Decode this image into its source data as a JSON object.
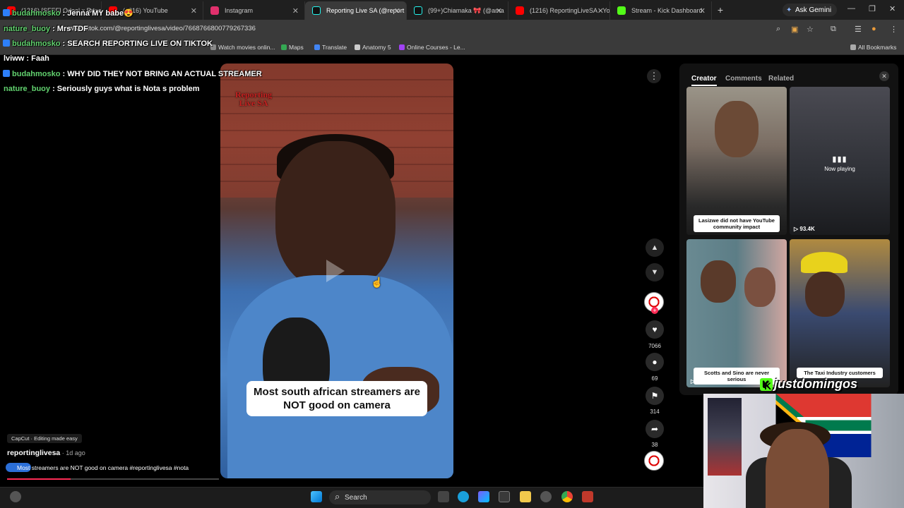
{
  "browser": {
    "tabs": [
      {
        "label": "(1216) [SFEF] Odeal x Rosa",
        "color": "#ff0000"
      },
      {
        "label": "(1216) YouTube",
        "color": "#ff0000"
      },
      {
        "label": "Instagram",
        "color": "#e1306c"
      },
      {
        "label": "Reporting Live SA (@report",
        "color": "#111111",
        "active": true
      },
      {
        "label": "(99+)Chiamaka 🎀 (@ama",
        "color": "#111111"
      },
      {
        "label": "(1216) ReportingLiveSA - Yo",
        "color": "#ff0000"
      },
      {
        "label": "Stream - Kick Dashboard",
        "color": "#53fc18"
      }
    ],
    "new_tab": "+",
    "gemini": "Ask Gemini",
    "url": "www.tiktok.com/@reportinglivesa/video/7668766800779267336",
    "bookmarks": [
      "Watch movies onlin...",
      "Maps",
      "Translate",
      "Anatomy 5",
      "Online Courses - Le..."
    ],
    "all_bookmarks": "All Bookmarks"
  },
  "chat": [
    {
      "user": "budahmosko",
      "text": " : Jenna MY babe😍",
      "badge": true
    },
    {
      "user": "nature_buoy",
      "text": " : Mrs TDF",
      "badge": false
    },
    {
      "user": "budahmosko",
      "text": " : SEARCH REPORTING LIVE ON TIKTOK",
      "badge": true
    },
    {
      "user": "",
      "text": "lviww : Faah",
      "badge": false
    },
    {
      "user": "budahmosko",
      "text": " : WHY DID THEY NOT BRING AN ACTUAL STREAMER",
      "badge": true
    },
    {
      "user": "nature_buoy",
      "text": " : Seriously guys what is Nota s problem",
      "badge": false
    }
  ],
  "video": {
    "watermark": "Reporting Live SA",
    "caption": "Most south african streamers are NOT good on camera"
  },
  "actions": {
    "likes": "7066",
    "comments": "69",
    "saves": "314",
    "shares": "38"
  },
  "post": {
    "capcut": "CapCut · Editing made easy",
    "author": "reportinglivesa",
    "ago": " · 1d ago",
    "description": "Most streamers are NOT good on camera #reportinglivesa #nota",
    "progress": 0.3
  },
  "panel": {
    "tabs": [
      "Creator",
      "Comments",
      "Related"
    ],
    "thumbs": [
      {
        "label": "Lasizwe did not have YouTube community impact",
        "views": ""
      },
      {
        "label": "",
        "views": "93.4K",
        "now_playing": "Now playing"
      },
      {
        "label": "Scotts and Sino are never serious",
        "views": "10"
      },
      {
        "label": "The Taxi Industry customers",
        "views": ""
      }
    ]
  },
  "overlay": {
    "streamer": "justdomingos"
  },
  "taskbar": {
    "search": "Search"
  }
}
